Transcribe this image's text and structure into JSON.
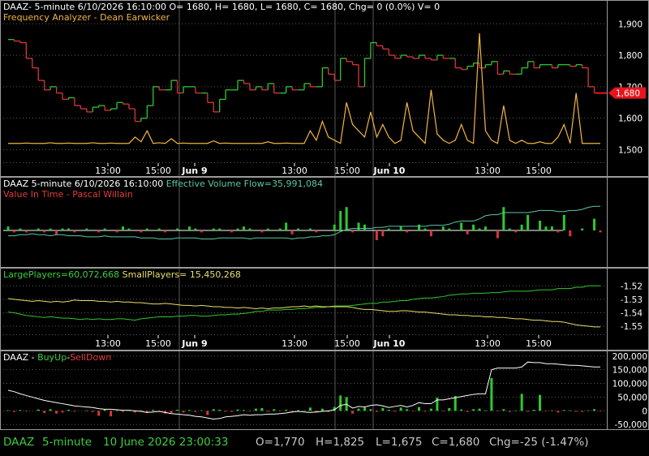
{
  "colors": {
    "background": "#000000",
    "grid": "#5a5a5a",
    "border": "#9a9a9a",
    "up": "#2ec92e",
    "down": "#d9373a",
    "white": "#ffffff",
    "yellow": "#e8df6a",
    "orange": "#f2b544",
    "teal": "#57c8a6",
    "green_label": "#3ccf3c",
    "red_label": "#e33b3b",
    "text_dim": "#c8c8c8",
    "price_tag": "#e8141e"
  },
  "panels": [
    {
      "id": "price",
      "header": [
        {
          "text": "DAAZ- 5-minute 6/10/2026 16:10:00 O= 1680, H= 1680, L= 1680, C= 1680, Chg= 0 (0.0%) V= 0",
          "color": "#ffffff"
        }
      ],
      "header2": [
        {
          "text": "Frequency Analyzer - Dean Earwicker",
          "color": "#f2b544"
        }
      ],
      "y_ticks": [
        "1,900",
        "1,800",
        "1,700",
        "1,600",
        "1,500"
      ],
      "x_ticks": [
        "13:00",
        "15:00",
        "Jun 9",
        "13:00",
        "15:00",
        "Jun 10",
        "13:00",
        "15:00"
      ],
      "price_tag": "1,680"
    },
    {
      "id": "volume",
      "header": [
        {
          "text": "DAAZ 5-minute  6/10/2026 16:10:00  ",
          "color": "#ffffff"
        },
        {
          "text": "Effective Volume Flow=35,991,084",
          "color": "#57c8a6"
        }
      ],
      "header2": [
        {
          "text": "Value In Time - Pascal Willain",
          "color": "#e33b3b"
        }
      ]
    },
    {
      "id": "players",
      "header": [
        {
          "text": "LargePlayers=60,072,668",
          "color": "#3ccf3c"
        },
        {
          "text": "    SmallPlayers= 15,450,268",
          "color": "#e8df6a"
        }
      ],
      "y_ticks": [
        "-1.52",
        "-1.53",
        "-1.54",
        "-1.55"
      ],
      "x_ticks": [
        "13:00",
        "15:00",
        "Jun 9",
        "13:00",
        "15:00",
        "Jun 10",
        "13:00",
        "15:00"
      ]
    },
    {
      "id": "buyup",
      "header": [
        {
          "text": "DAAZ - ",
          "color": "#ffffff"
        },
        {
          "text": "BuyUp",
          "color": "#3ccf3c"
        },
        {
          "text": "-",
          "color": "#ffffff"
        },
        {
          "text": "SellDown",
          "color": "#e33b3b"
        }
      ],
      "y_ticks": [
        "200,000",
        "150,000",
        "100,000",
        "50,000",
        "0",
        "-50,000"
      ]
    }
  ],
  "status_bar": {
    "symbol": "DAAZ",
    "interval": "5-minute",
    "datetime": "10 June 2026 23:00:33",
    "open": "O=1,770",
    "high": "H=1,825",
    "low": "L=1,675",
    "close": "C=1,680",
    "change": "Chg=-25 (-1.47%)"
  },
  "chart_data": [
    {
      "type": "line",
      "title": "DAAZ- 5-minute 6/10/2026 16:10:00 O= 1680, H= 1680, L= 1680, C= 1680, Chg= 0 (0.0%) V= 0",
      "x_ticks": [
        "13:00",
        "15:00",
        "Jun 9",
        "13:00",
        "15:00",
        "Jun 10",
        "13:00",
        "15:00"
      ],
      "ylim": [
        1460,
        1960
      ],
      "series": [
        {
          "name": "DAAZ",
          "style": "step-candles",
          "values": [
            1850,
            1845,
            1840,
            1790,
            1760,
            1720,
            1690,
            1700,
            1680,
            1660,
            1665,
            1640,
            1630,
            1620,
            1635,
            1640,
            1625,
            1630,
            1650,
            1645,
            1630,
            1590,
            1600,
            1640,
            1700,
            1690,
            1690,
            1720,
            1680,
            1700,
            1700,
            1680,
            1680,
            1650,
            1620,
            1660,
            1690,
            1690,
            1720,
            1710,
            1690,
            1700,
            1690,
            1710,
            1680,
            1680,
            1700,
            1690,
            1690,
            1710,
            1700,
            1700,
            1760,
            1740,
            1720,
            1790,
            1780,
            1770,
            1700,
            1790,
            1840,
            1830,
            1820,
            1800,
            1790,
            1800,
            1795,
            1790,
            1800,
            1790,
            1785,
            1800,
            1790,
            1790,
            1760,
            1755,
            1765,
            1775,
            1760,
            1770,
            1780,
            1740,
            1750,
            1740,
            1740,
            1760,
            1780,
            1760,
            1770,
            1770,
            1760,
            1770,
            1770,
            1765,
            1770,
            1760,
            1700,
            1680,
            1680
          ]
        },
        {
          "name": "Frequency Analyzer - Dean Earwicker",
          "style": "line",
          "values": [
            1520,
            1520,
            1520,
            1521,
            1520,
            1520,
            1520,
            1522,
            1520,
            1520,
            1521,
            1520,
            1520,
            1520,
            1522,
            1520,
            1520,
            1521,
            1520,
            1520,
            1520,
            1540,
            1525,
            1560,
            1520,
            1522,
            1520,
            1535,
            1520,
            1521,
            1520,
            1520,
            1520,
            1520,
            1528,
            1520,
            1521,
            1520,
            1520,
            1520,
            1520,
            1520,
            1520,
            1525,
            1520,
            1520,
            1521,
            1520,
            1520,
            1520,
            1560,
            1530,
            1590,
            1540,
            1530,
            1520,
            1650,
            1580,
            1560,
            1540,
            1620,
            1540,
            1580,
            1540,
            1520,
            1530,
            1650,
            1560,
            1540,
            1520,
            1690,
            1550,
            1530,
            1520,
            1530,
            1580,
            1530,
            1520,
            1870,
            1560,
            1530,
            1520,
            1640,
            1530,
            1520,
            1530,
            1520,
            1520,
            1525,
            1520,
            1520,
            1540,
            1580,
            1520,
            1680,
            1520,
            1520,
            1520,
            1520
          ]
        }
      ]
    },
    {
      "type": "bar",
      "title": "Effective Volume Flow=35,991,084",
      "series": [
        {
          "name": "Effective Volume Flow",
          "style": "line",
          "values": [
            -2,
            -2,
            -1,
            -1,
            0,
            -1,
            -1,
            -2,
            -1,
            -1,
            -2,
            -2,
            -2,
            -3,
            -3,
            -3,
            -2,
            -3,
            -3,
            -3,
            -3,
            -3,
            -4,
            -4,
            -4,
            -5,
            -5,
            -5,
            -4,
            -4,
            -4,
            -4,
            -5,
            -5,
            -5,
            -4,
            -4,
            -4,
            -4,
            -4,
            -5,
            -4,
            -4,
            -4,
            -4,
            -4,
            -4,
            -5,
            -4,
            -4,
            -3,
            -3,
            -2,
            -2,
            -1,
            2,
            4,
            5,
            5,
            5,
            5,
            6,
            6,
            7,
            7,
            7,
            7,
            7,
            7,
            7,
            8,
            8,
            8,
            9,
            11,
            12,
            12,
            12,
            14,
            17,
            18,
            18,
            20,
            20,
            20,
            20,
            20,
            21,
            22,
            22,
            22,
            21,
            21,
            22,
            22,
            23,
            25,
            26,
            26
          ]
        },
        {
          "name": "Value In Time - Pascal Willain",
          "style": "bars",
          "values": [
            2,
            -1,
            1,
            -1,
            0,
            1,
            -1,
            1,
            -2,
            1,
            1,
            -1,
            0,
            1,
            0,
            -1,
            1,
            0,
            -1,
            2,
            1,
            0,
            -1,
            1,
            0,
            1,
            -1,
            0,
            1,
            0,
            2,
            1,
            -1,
            0,
            1,
            1,
            0,
            -1,
            1,
            2,
            1,
            0,
            -1,
            1,
            0,
            1,
            4,
            -2,
            1,
            0,
            1,
            -1,
            0,
            0,
            3,
            10,
            12,
            -1,
            4,
            3,
            0,
            -5,
            -3,
            1,
            0,
            2,
            -1,
            0,
            3,
            1,
            -3,
            0,
            2,
            1,
            0,
            4,
            -2,
            3,
            1,
            2,
            0,
            -4,
            12,
            1,
            -1,
            3,
            8,
            0,
            5,
            2,
            2,
            -1,
            8,
            -3,
            0,
            1,
            0,
            6,
            -1
          ]
        }
      ]
    },
    {
      "type": "line",
      "title": "LargePlayers=60,072,668  SmallPlayers= 15,450,268",
      "ylim": [
        -1.556,
        -1.515
      ],
      "series": [
        {
          "name": "LargePlayers",
          "values": [
            -1.5395,
            -1.54,
            -1.541,
            -1.542,
            -1.5425,
            -1.543,
            -1.5435,
            -1.543,
            -1.5435,
            -1.544,
            -1.544,
            -1.5445,
            -1.545,
            -1.5445,
            -1.545,
            -1.5445,
            -1.545,
            -1.545,
            -1.5445,
            -1.5445,
            -1.545,
            -1.5455,
            -1.5445,
            -1.544,
            -1.5435,
            -1.543,
            -1.543,
            -1.543,
            -1.5425,
            -1.5425,
            -1.542,
            -1.542,
            -1.5425,
            -1.5425,
            -1.542,
            -1.5415,
            -1.5415,
            -1.541,
            -1.541,
            -1.5405,
            -1.54,
            -1.539,
            -1.539,
            -1.538,
            -1.538,
            -1.538,
            -1.5375,
            -1.5375,
            -1.537,
            -1.537,
            -1.5365,
            -1.536,
            -1.536,
            -1.5355,
            -1.535,
            -1.535,
            -1.535,
            -1.5345,
            -1.534,
            -1.5335,
            -1.533,
            -1.533,
            -1.532,
            -1.532,
            -1.5315,
            -1.531,
            -1.531,
            -1.53,
            -1.5295,
            -1.529,
            -1.529,
            -1.5285,
            -1.528,
            -1.527,
            -1.5265,
            -1.526,
            -1.526,
            -1.5255,
            -1.5255,
            -1.5255,
            -1.525,
            -1.525,
            -1.5245,
            -1.524,
            -1.524,
            -1.524,
            -1.524,
            -1.5235,
            -1.523,
            -1.523,
            -1.523,
            -1.522,
            -1.522,
            -1.522,
            -1.521,
            -1.521,
            -1.52,
            -1.52,
            -1.52
          ]
        },
        {
          "name": "SmallPlayers",
          "values": [
            -1.5295,
            -1.53,
            -1.5305,
            -1.531,
            -1.5315,
            -1.531,
            -1.5315,
            -1.532,
            -1.5315,
            -1.532,
            -1.5315,
            -1.5305,
            -1.531,
            -1.531,
            -1.531,
            -1.5315,
            -1.5315,
            -1.532,
            -1.5315,
            -1.532,
            -1.532,
            -1.5325,
            -1.5325,
            -1.533,
            -1.5335,
            -1.5335,
            -1.533,
            -1.5335,
            -1.534,
            -1.5345,
            -1.5345,
            -1.535,
            -1.5345,
            -1.535,
            -1.5355,
            -1.5355,
            -1.536,
            -1.536,
            -1.5365,
            -1.536,
            -1.5365,
            -1.537,
            -1.5365,
            -1.537,
            -1.5365,
            -1.5365,
            -1.536,
            -1.5355,
            -1.5355,
            -1.535,
            -1.5355,
            -1.535,
            -1.5355,
            -1.5355,
            -1.5355,
            -1.5355,
            -1.5355,
            -1.536,
            -1.537,
            -1.5375,
            -1.5375,
            -1.538,
            -1.5385,
            -1.539,
            -1.539,
            -1.5385,
            -1.5385,
            -1.539,
            -1.5395,
            -1.5395,
            -1.54,
            -1.5405,
            -1.541,
            -1.5415,
            -1.5415,
            -1.542,
            -1.542,
            -1.5425,
            -1.5425,
            -1.543,
            -1.543,
            -1.5435,
            -1.5435,
            -1.544,
            -1.5445,
            -1.5445,
            -1.545,
            -1.5455,
            -1.5455,
            -1.546,
            -1.5465,
            -1.5465,
            -1.547,
            -1.548,
            -1.549,
            -1.5495,
            -1.55,
            -1.5505,
            -1.5505
          ]
        }
      ]
    },
    {
      "type": "bar",
      "title": "DAAZ - BuyUp-SellDown",
      "ylim": [
        -70000,
        220000
      ],
      "series": [
        {
          "name": "BuyUp-SellDown",
          "style": "line",
          "values": [
            75000,
            70000,
            62000,
            56000,
            50000,
            44000,
            38000,
            34000,
            30000,
            26000,
            22000,
            18000,
            16000,
            14000,
            12000,
            8000,
            6000,
            6000,
            4000,
            2000,
            2000,
            0,
            -2000,
            -6000,
            -4000,
            -2000,
            -6000,
            -10000,
            -12000,
            -14000,
            -16000,
            -20000,
            -22000,
            -26000,
            -30000,
            -28000,
            -22000,
            -20000,
            -18000,
            -14000,
            -16000,
            -14000,
            -14000,
            -12000,
            -12000,
            -10000,
            -8000,
            -4000,
            -2000,
            -4000,
            -6000,
            -4000,
            -2000,
            0,
            4000,
            20000,
            24000,
            10000,
            16000,
            14000,
            20000,
            22000,
            18000,
            12000,
            16000,
            20000,
            14000,
            20000,
            30000,
            26000,
            26000,
            40000,
            40000,
            44000,
            48000,
            52000,
            56000,
            60000,
            62000,
            62000,
            150000,
            156000,
            156000,
            156000,
            156000,
            160000,
            178000,
            176000,
            176000,
            172000,
            172000,
            170000,
            168000,
            166000,
            166000,
            164000,
            162000,
            160000,
            160000
          ]
        },
        {
          "name": "BuyUp-SellDown bars",
          "style": "bars",
          "values": [
            2000,
            -4000,
            3000,
            -2000,
            0,
            5000,
            -8000,
            6000,
            -10000,
            -6000,
            4000,
            -3000,
            0,
            2000,
            -4000,
            -18000,
            5000,
            -20000,
            2000,
            -4000,
            3000,
            -6000,
            2000,
            -8000,
            4000,
            -2000,
            -10000,
            -8000,
            4000,
            -6000,
            3000,
            -4000,
            2000,
            -15000,
            6000,
            4000,
            -3000,
            -4000,
            5000,
            3000,
            -2000,
            8000,
            10000,
            -3000,
            6000,
            -2000,
            4000,
            -4000,
            3000,
            2000,
            12000,
            -6000,
            8000,
            -4000,
            14000,
            56000,
            50000,
            -10000,
            8000,
            12000,
            6000,
            -4000,
            10000,
            4000,
            -3000,
            12000,
            6000,
            -2000,
            14000,
            -3000,
            8000,
            48000,
            -2000,
            10000,
            54000,
            5000,
            -4000,
            6000,
            8000,
            2000,
            120000,
            -2000,
            6000,
            -4000,
            2000,
            62000,
            -3000,
            4000,
            58000,
            -2000,
            2000,
            -6000,
            3000,
            2000,
            -3000,
            -4000,
            2000,
            6000,
            -2000
          ]
        }
      ]
    }
  ]
}
